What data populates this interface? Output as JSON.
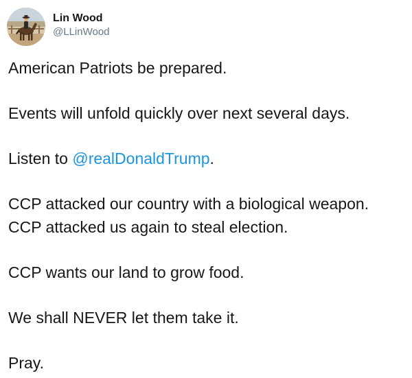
{
  "author": {
    "display_name": "Lin Wood",
    "handle": "@LLinWood",
    "avatar_icon": "horse-rider-avatar"
  },
  "tweet": {
    "line1": "American Patriots be prepared.",
    "line2": "Events will unfold quickly over next several days.",
    "line3_prefix": "Listen to ",
    "line3_mention": "@realDonaldTrump",
    "line3_suffix": ".",
    "line4": "CCP attacked our country with a biological weapon.",
    "line5": "CCP attacked us again to steal election.",
    "line6": "CCP wants our land to grow food.",
    "line7": "We shall NEVER let them take it.",
    "line8": "Pray."
  },
  "colors": {
    "text": "#14171a",
    "secondary": "#657786",
    "link": "#1b95e0",
    "background": "#ffffff"
  }
}
